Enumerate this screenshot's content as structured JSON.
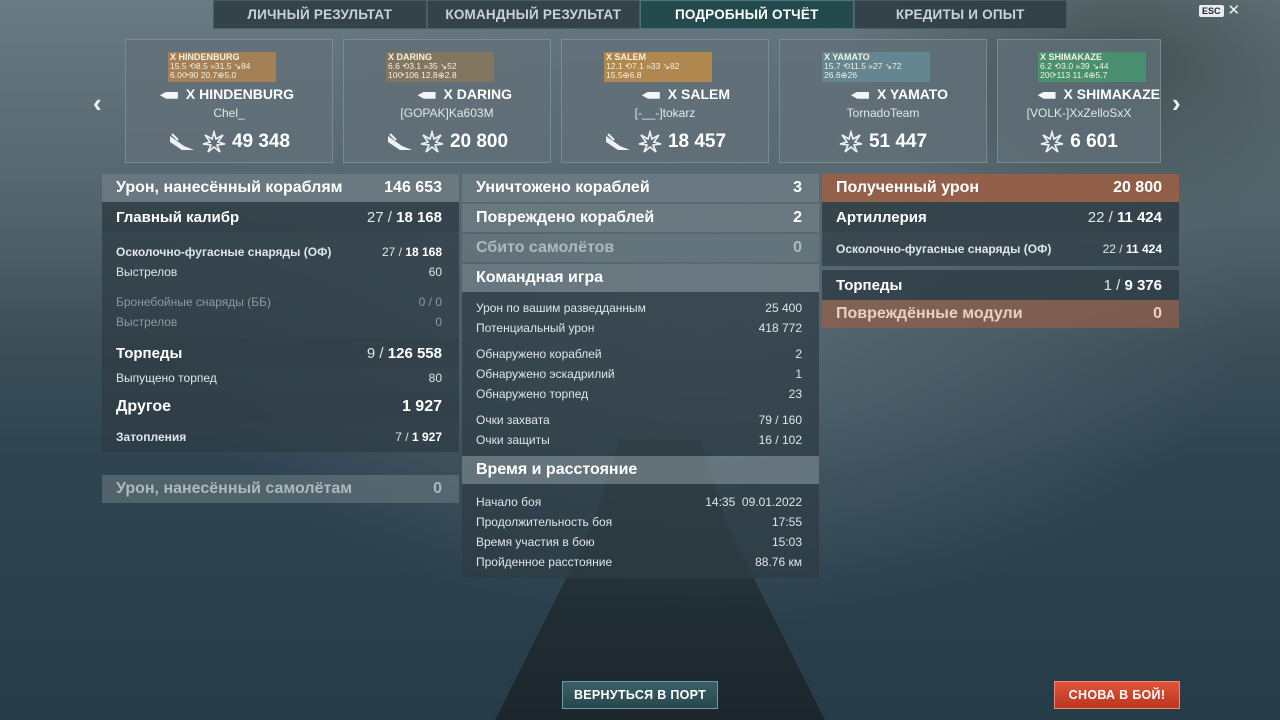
{
  "tabs": [
    {
      "label": "ЛИЧНЫЙ РЕЗУЛЬТАТ"
    },
    {
      "label": "КОМАНДНЫЙ РЕЗУЛЬТАТ"
    },
    {
      "label": "ПОДРОБНЫЙ ОТЧЁТ",
      "active": true
    },
    {
      "label": "КРЕДИТЫ И ОПЫТ"
    }
  ],
  "esc": {
    "key": "ESC",
    "close": "✕"
  },
  "nav": {
    "prev": "‹",
    "next": "›"
  },
  "ships": [
    {
      "mini_name": "X HINDENBURG",
      "mini_row1": "15.5 ⟲8.5  »31.5  ↘84",
      "mini_row2": "6.0⟳90   20.7⊕5.0",
      "name": "X HINDENBURG",
      "player": "Chel_",
      "damage": "49 348",
      "ram": true
    },
    {
      "mini_name": "X DARING",
      "mini_row1": "6.6 ⟲3.1  »35  ↘52",
      "mini_row2": "10⟳106   12.8⊕2.8",
      "name": "X DARING",
      "player": "[GOPAK]Ka603M",
      "damage": "20 800",
      "ram": true
    },
    {
      "mini_name": "X SALEM",
      "mini_row1": "12.1 ⟲7.1  »33  ↘82",
      "mini_row2": "15.5⊕6.8",
      "name": "X SALEM",
      "player": "[-__-]tokarz",
      "damage": "18 457",
      "ram": true
    },
    {
      "mini_name": "X YAMATO",
      "mini_row1": "15.7 ⟲11.5  »27  ↘72",
      "mini_row2": "26.6⊕26",
      "name": "X YAMATO",
      "player": "TornadoTeam",
      "damage": "51 447",
      "ram": false
    },
    {
      "mini_name": "X SHIMAKAZE",
      "mini_row1": "6.2 ⟲3.0  »39  ↘44",
      "mini_row2": "20⟳113   11.4⊕5.7",
      "name": "X SHIMAKAZE",
      "player": "[VOLK-]XxZelloSxX",
      "damage": "6 601",
      "ram": false
    }
  ],
  "left": {
    "damage_ships": {
      "label": "Урон, нанесённый кораблям",
      "value": "146 653"
    },
    "main_battery": {
      "label": "Главный калибр",
      "hits": "27 /",
      "value": "18 168"
    },
    "he": {
      "label": "Осколочно-фугасные снаряды (ОФ)",
      "hits": "27 /",
      "value": "18 168"
    },
    "he_shots": {
      "label": "Выстрелов",
      "value": "60"
    },
    "ap": {
      "label": "Бронебойные снаряды (ББ)",
      "value": "0 / 0"
    },
    "ap_shots": {
      "label": "Выстрелов",
      "value": "0"
    },
    "torpedoes": {
      "label": "Торпеды",
      "hits": "9 /",
      "value": "126 558"
    },
    "torp_launched": {
      "label": "Выпущено торпед",
      "value": "80"
    },
    "other": {
      "label": "Другое",
      "value": "1 927"
    },
    "flooding": {
      "label": "Затопления",
      "hits": "7 /",
      "value": "1 927"
    },
    "damage_planes": {
      "label": "Урон, нанесённый самолётам",
      "value": "0"
    }
  },
  "middle": {
    "destroyed": {
      "label": "Уничтожено кораблей",
      "value": "3"
    },
    "damaged": {
      "label": "Повреждено кораблей",
      "value": "2"
    },
    "planes": {
      "label": "Сбито самолётов",
      "value": "0"
    },
    "team_head": "Командная игра",
    "team": [
      {
        "label": "Урон по вашим разведданным",
        "value": "25 400"
      },
      {
        "label": "Потенциальный урон",
        "value": "418 772"
      },
      {
        "label": "Обнаружено кораблей",
        "value": "2"
      },
      {
        "label": "Обнаружено эскадрилий",
        "value": "1"
      },
      {
        "label": "Обнаружено торпед",
        "value": "23"
      },
      {
        "label": "Очки захвата",
        "value": "79 / 160"
      },
      {
        "label": "Очки защиты",
        "value": "16 / 102"
      }
    ],
    "time_head": "Время и расстояние",
    "time": [
      {
        "label": "Начало боя",
        "value": "14:35  09.01.2022"
      },
      {
        "label": "Продолжительность боя",
        "value": "17:55"
      },
      {
        "label": "Время участия в бою",
        "value": "15:03"
      },
      {
        "label": "Пройденное расстояние",
        "value": "88.76 км"
      }
    ]
  },
  "right": {
    "received": {
      "label": "Полученный урон",
      "value": "20 800"
    },
    "artillery": {
      "label": "Артиллерия",
      "hits": "22 /",
      "value": "11 424"
    },
    "he": {
      "label": "Осколочно-фугасные снаряды (ОФ)",
      "hits": "22 /",
      "value": "11 424"
    },
    "torpedoes": {
      "label": "Торпеды",
      "hits": "1 /",
      "value": "9 376"
    },
    "modules": {
      "label": "Повреждённые модули",
      "value": "0"
    }
  },
  "buttons": {
    "port": "ВЕРНУТЬСЯ В ПОРТ",
    "battle": "СНОВА В БОЙ!"
  },
  "colors": {
    "accent_team": "#22484c",
    "received_header": "#a05f41",
    "battle_button": "#d04a30",
    "port_button": "#325860"
  }
}
